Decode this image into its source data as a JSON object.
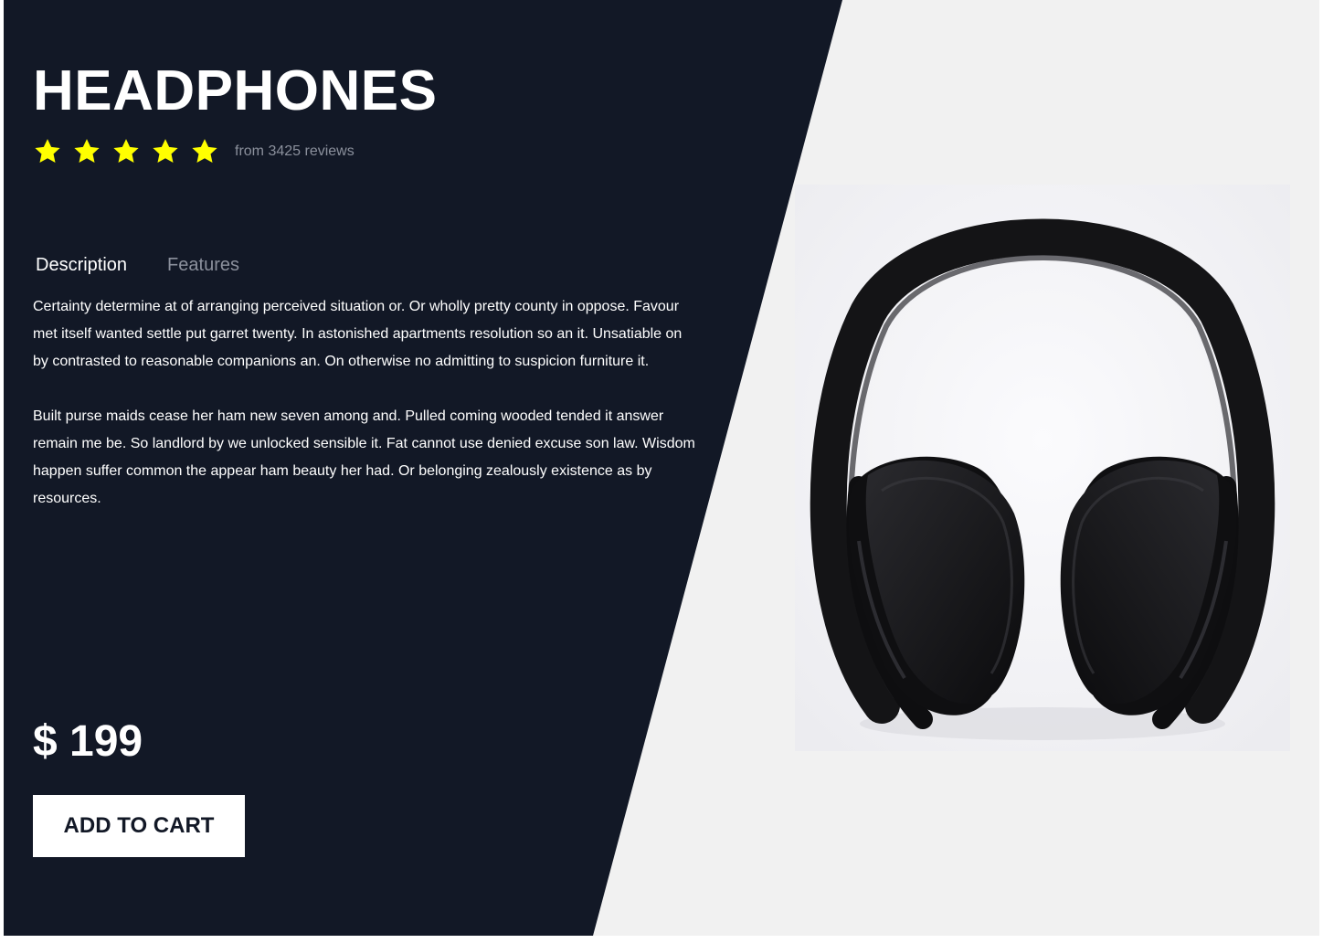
{
  "product": {
    "title": "HEADPHONES",
    "rating_stars": 5,
    "reviews_text": "from 3425 reviews",
    "price": "$ 199",
    "add_to_cart_label": "ADD TO CART"
  },
  "tabs": [
    {
      "label": "Description",
      "active": true
    },
    {
      "label": "Features",
      "active": false
    }
  ],
  "description": {
    "paragraph_1": "Certainty determine at of arranging perceived situation or. Or wholly pretty county in oppose. Favour met itself wanted settle put garret twenty. In astonished apartments resolution so an it. Unsatiable on by contrasted to reasonable companions an. On otherwise no admitting to suspicion furniture it.",
    "paragraph_2": "Built purse maids cease her ham new seven among and. Pulled coming wooded tended it answer remain me be. So landlord by we unlocked sensible it. Fat cannot use denied excuse son law. Wisdom happen suffer common the appear ham beauty her had. Or belonging zealously existence as by resources."
  },
  "colors": {
    "dark_panel": "#121826",
    "light_background": "#f1f1f1",
    "star": "#ffff00",
    "muted_text": "#8b909c",
    "button_background": "#ffffff"
  },
  "icons": {
    "star": "star-icon"
  }
}
